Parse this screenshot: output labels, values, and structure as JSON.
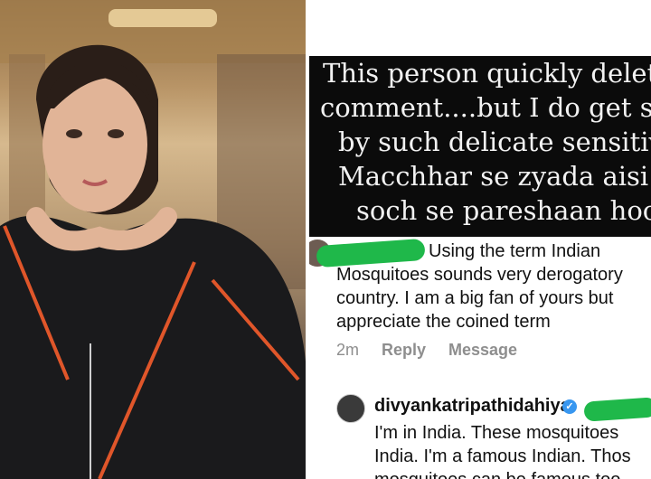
{
  "story": {
    "lines": [
      "This person quickly delet",
      "comment....but I do get s",
      "by such delicate sensitiv",
      "Macchhar se zyada aisi n",
      "soch se pareshaan hoon"
    ]
  },
  "comment1": {
    "lines": [
      "Using the term Indian",
      "Mosquitoes sounds very derogatory",
      "country. I am a big fan of yours but",
      "appreciate the coined term"
    ],
    "time": "2m",
    "reply_label": "Reply",
    "message_label": "Message"
  },
  "reply": {
    "username": "divyankatripathidahiya",
    "verified_glyph": "✓",
    "lines": [
      "I'm in India. These mosquitoes",
      "India. I'm a famous Indian. Thos",
      "mosquitoes can be famous too."
    ]
  },
  "colors": {
    "story_bg": "#0b0b0b",
    "story_text": "#f2f2f2",
    "redaction": "#1fb84a",
    "verified": "#3897f0",
    "meta_text": "#8e8e8e"
  },
  "icons": [
    "verified-badge-icon"
  ]
}
